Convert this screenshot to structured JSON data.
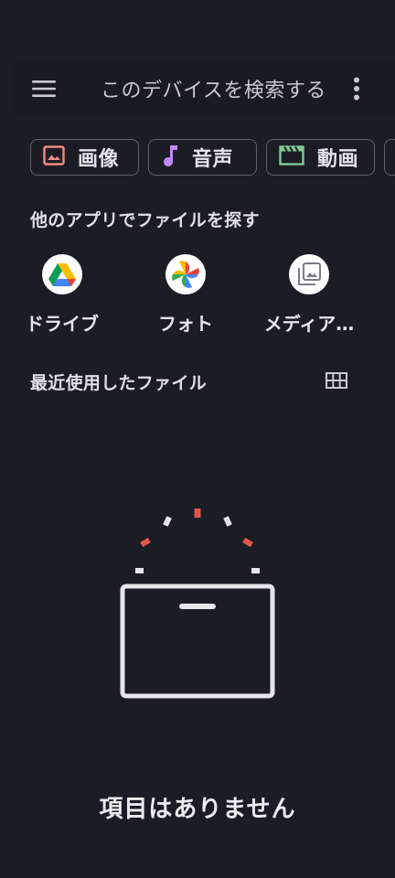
{
  "search": {
    "placeholder": "このデバイスを検索する",
    "menu_icon": "hamburger-menu-icon",
    "more_icon": "more-vert-icon"
  },
  "chips": [
    {
      "label": "画像",
      "icon": "image-icon",
      "color": "#f28b82"
    },
    {
      "label": "音声",
      "icon": "music-note-icon",
      "color": "#c58af9"
    },
    {
      "label": "動画",
      "icon": "movie-icon",
      "color": "#81c995"
    }
  ],
  "apps_section": {
    "title": "他のアプリでファイルを探す",
    "apps": [
      {
        "label": "ドライブ",
        "icon": "google-drive-icon"
      },
      {
        "label": "フォト",
        "icon": "google-photos-icon"
      },
      {
        "label": "メディア…",
        "icon": "media-gallery-icon"
      }
    ]
  },
  "recent_section": {
    "title": "最近使用したファイル",
    "view_toggle_icon": "grid-view-icon"
  },
  "empty_state": {
    "message": "項目はありません",
    "illustration": "empty-box-illustration"
  },
  "colors": {
    "background": "#1c1d24",
    "accent_red": "#e0574a"
  }
}
